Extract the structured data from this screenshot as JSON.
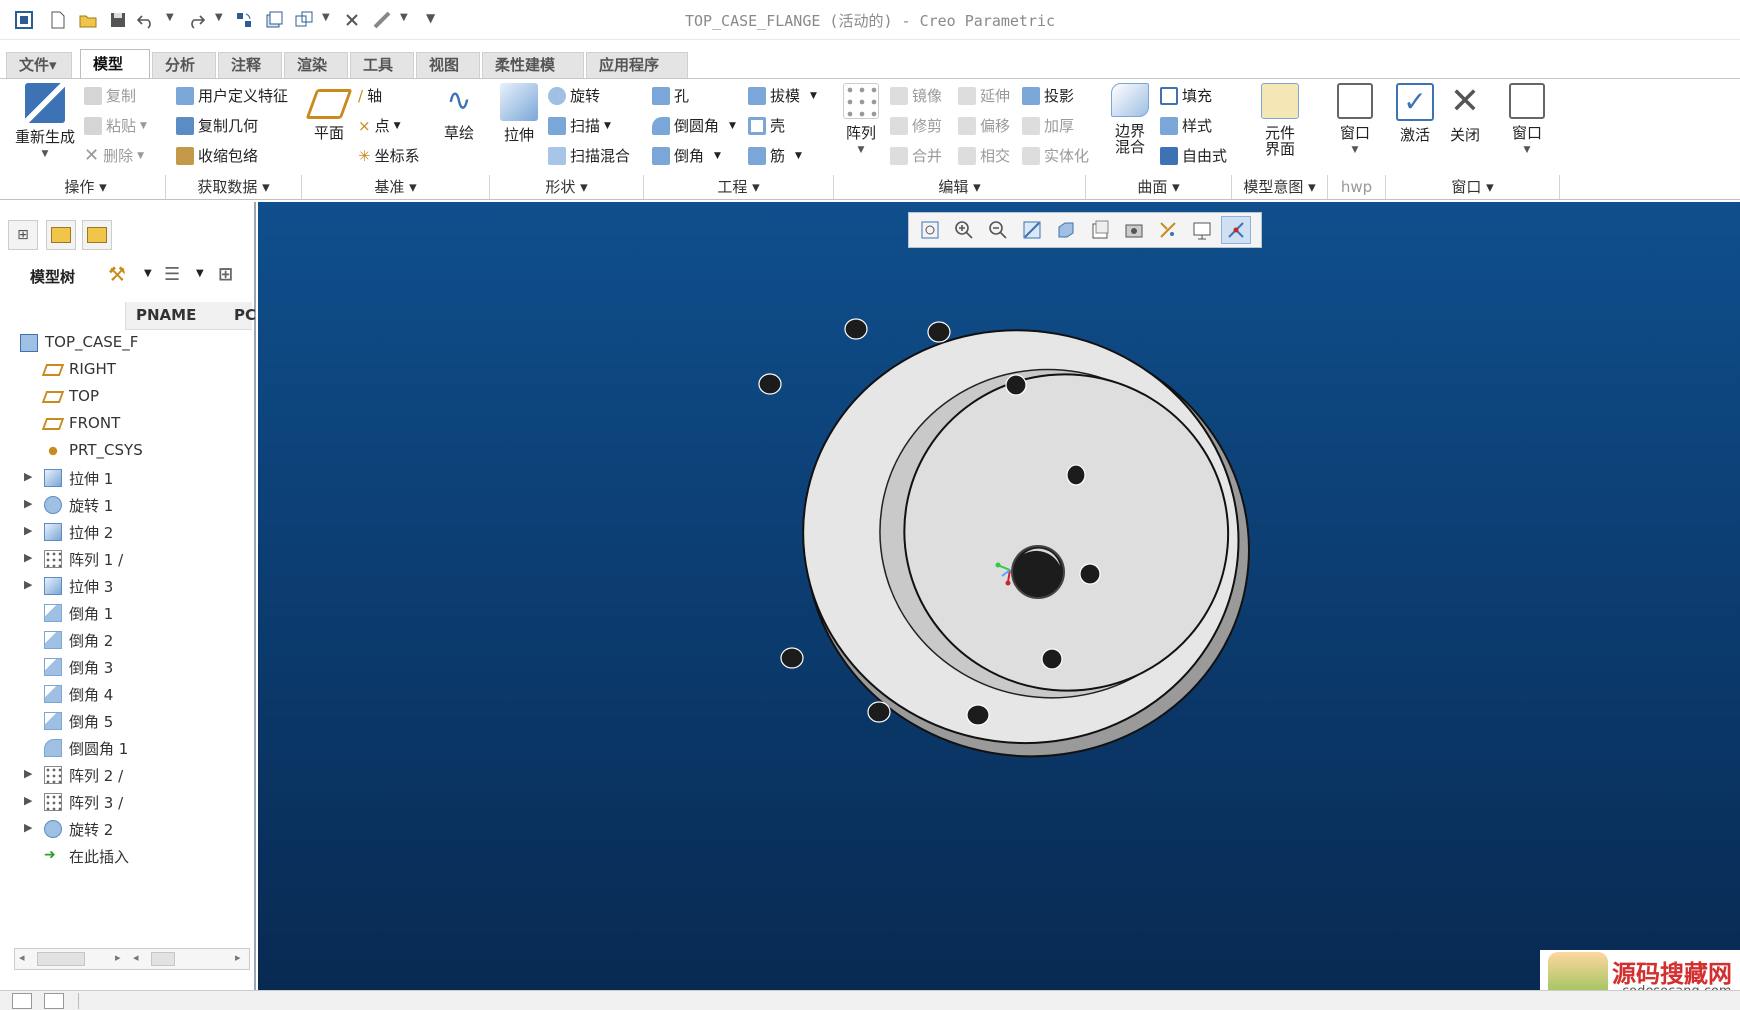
{
  "window": {
    "title": "TOP_CASE_FLANGE (活动的) - Creo Parametric"
  },
  "tabs": [
    {
      "label": "文件▾"
    },
    {
      "label": "模型",
      "active": true
    },
    {
      "label": "分析"
    },
    {
      "label": "注释"
    },
    {
      "label": "渲染"
    },
    {
      "label": "工具"
    },
    {
      "label": "视图"
    },
    {
      "label": "柔性建模"
    },
    {
      "label": "应用程序"
    }
  ],
  "ribbon": {
    "ops": {
      "regen": "重新生成",
      "copy": "复制",
      "paste": "粘贴",
      "delete": "删除",
      "group": "操作"
    },
    "getdata": {
      "udf": "用户定义特征",
      "copygeom": "复制几何",
      "shrinkwrap": "收缩包络",
      "group": "获取数据"
    },
    "datum": {
      "plane": "平面",
      "axis": "轴",
      "point": "点",
      "csys": "坐标系",
      "sketch": "草绘",
      "group": "基准"
    },
    "shapes": {
      "extrude": "拉伸",
      "revolve": "旋转",
      "sweep": "扫描",
      "blend": "扫描混合",
      "group": "形状"
    },
    "eng": {
      "hole": "孔",
      "round": "倒圆角",
      "chamfer": "倒角",
      "draft": "拔模",
      "shell": "壳",
      "rib": "筋",
      "group": "工程"
    },
    "edit": {
      "pattern": "阵列",
      "mirror": "镜像",
      "trim": "修剪",
      "merge": "合并",
      "extend": "延伸",
      "offset": "偏移",
      "intersect": "相交",
      "project": "投影",
      "thicken": "加厚",
      "solidify": "实体化",
      "group": "编辑"
    },
    "surf": {
      "boundary": "边界混合",
      "fill": "填充",
      "style": "样式",
      "freestyle": "自由式",
      "group": "曲面"
    },
    "intent": {
      "comp": "元件界面",
      "group": "模型意图"
    },
    "hwp": {
      "window": "窗口",
      "group": "hwp"
    },
    "win": {
      "activate": "激活",
      "close": "关闭",
      "window": "窗口",
      "group": "窗口"
    }
  },
  "tree": {
    "title": "模型树",
    "col_name": "PNAME",
    "col_pc": "PC",
    "items": [
      {
        "label": "TOP_CASE_F",
        "icon": "part-icon"
      },
      {
        "label": "RIGHT",
        "icon": "datum-plane-icon"
      },
      {
        "label": "TOP",
        "icon": "datum-plane-icon"
      },
      {
        "label": "FRONT",
        "icon": "datum-plane-icon"
      },
      {
        "label": "PRT_CSYS",
        "icon": "csys-icon"
      },
      {
        "label": "拉伸 1",
        "icon": "extrude-icon",
        "expandable": true
      },
      {
        "label": "旋转 1",
        "icon": "revolve-icon",
        "expandable": true
      },
      {
        "label": "拉伸 2",
        "icon": "extrude-icon",
        "expandable": true
      },
      {
        "label": "阵列 1 /",
        "icon": "pattern-icon",
        "expandable": true
      },
      {
        "label": "拉伸 3",
        "icon": "extrude-icon",
        "expandable": true
      },
      {
        "label": "倒角 1",
        "icon": "chamfer-icon"
      },
      {
        "label": "倒角 2",
        "icon": "chamfer-icon"
      },
      {
        "label": "倒角 3",
        "icon": "chamfer-icon"
      },
      {
        "label": "倒角 4",
        "icon": "chamfer-icon"
      },
      {
        "label": "倒角 5",
        "icon": "chamfer-icon"
      },
      {
        "label": "倒圆角 1",
        "icon": "round-icon"
      },
      {
        "label": "阵列 2 /",
        "icon": "pattern-icon",
        "expandable": true
      },
      {
        "label": "阵列 3 /",
        "icon": "pattern-icon",
        "expandable": true
      },
      {
        "label": "旋转 2",
        "icon": "revolve-icon",
        "expandable": true
      },
      {
        "label": "在此插入",
        "icon": "insert-here-icon"
      }
    ]
  },
  "watermark": {
    "title": "源码搜藏网",
    "url": "codesocang.com"
  },
  "colors": {
    "accent": "#2b5c93",
    "viewport_top": "#0f4f8c",
    "viewport_bottom": "#082a52",
    "model": "#e6e6e6"
  }
}
